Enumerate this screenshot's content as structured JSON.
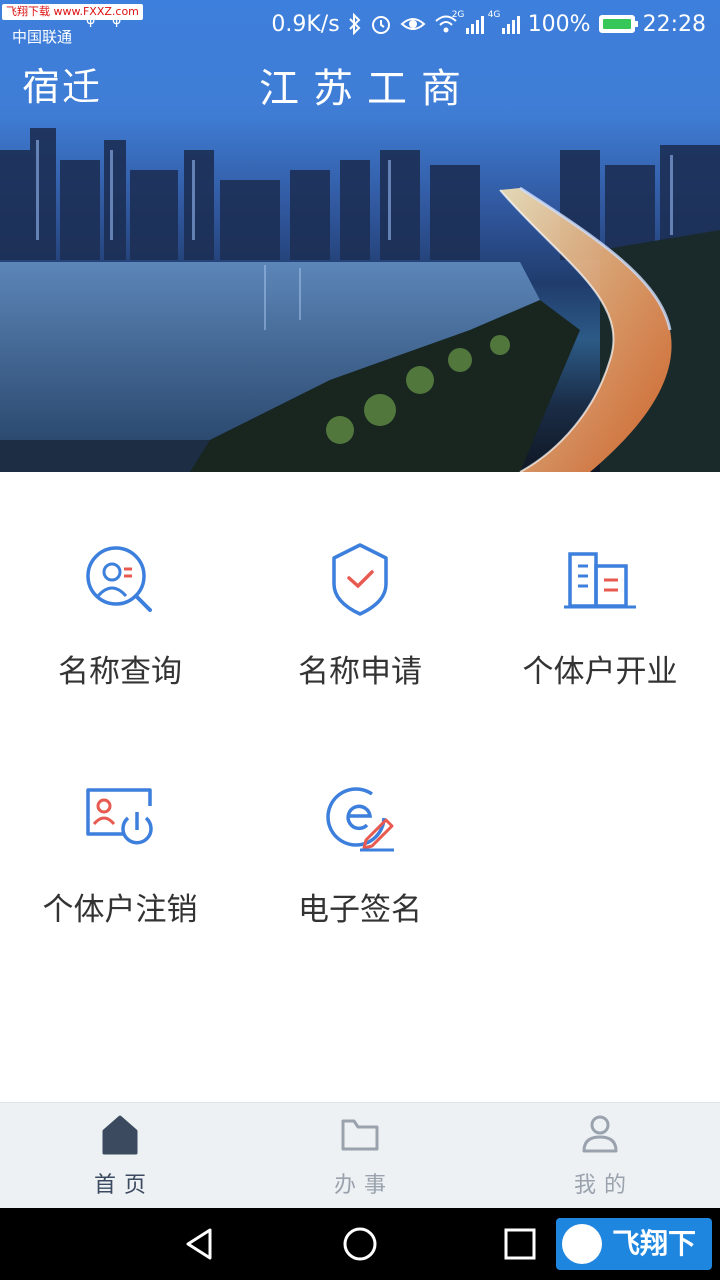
{
  "status": {
    "carrier_small": "飞翔下载 www.FXXZ.com",
    "carrier": "中国联通",
    "speed": "0.9K/s",
    "net1": "2G",
    "net2": "4G",
    "battery": "100%",
    "time": "22:28"
  },
  "header": {
    "city": "宿迁",
    "title": "江苏工商"
  },
  "services": [
    {
      "label": "名称查询",
      "icon": "name-search-icon"
    },
    {
      "label": "名称申请",
      "icon": "shield-check-icon"
    },
    {
      "label": "个体户开业",
      "icon": "building-icon"
    },
    {
      "label": "个体户注销",
      "icon": "id-card-power-icon"
    },
    {
      "label": "电子签名",
      "icon": "e-signature-icon"
    }
  ],
  "tabs": [
    {
      "label": "首页",
      "icon": "home-icon",
      "active": true
    },
    {
      "label": "办事",
      "icon": "folder-icon",
      "active": false
    },
    {
      "label": "我的",
      "icon": "user-icon",
      "active": false
    }
  ],
  "colors": {
    "accent": "#3d7fdc",
    "icon_red": "#e85a4f",
    "tab_active": "#3b4a5f",
    "tab_inactive": "#9aa3ad"
  },
  "watermark": "飞翔下载"
}
